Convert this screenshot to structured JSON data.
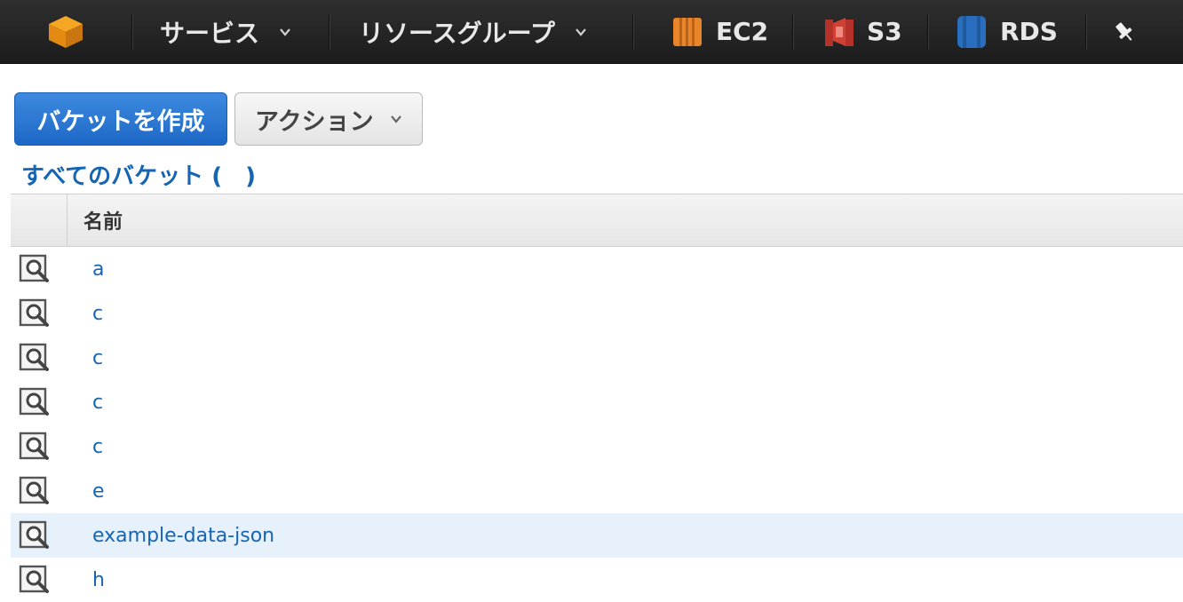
{
  "nav": {
    "services_label": "サービス",
    "resource_groups_label": "リソースグループ",
    "shortcuts": [
      {
        "label": "EC2",
        "color": "#e8852a"
      },
      {
        "label": "S3",
        "color": "#d04033"
      },
      {
        "label": "RDS",
        "color": "#2a6fbf"
      }
    ]
  },
  "toolbar": {
    "create_bucket_label": "バケットを作成",
    "actions_label": "アクション"
  },
  "bucket_list": {
    "title": "すべてのバケット (",
    "title_suffix": ")",
    "column_name": "名前",
    "rows": [
      {
        "name": "a"
      },
      {
        "name": "c"
      },
      {
        "name": "c"
      },
      {
        "name": "c"
      },
      {
        "name": "c"
      },
      {
        "name": "e"
      },
      {
        "name": "example-data-json",
        "selected": true
      },
      {
        "name": "h"
      }
    ]
  },
  "colors": {
    "topbar": "#232323",
    "primary": "#1d68c6",
    "link": "#1665b3",
    "selected_row": "#e6f1fb"
  }
}
